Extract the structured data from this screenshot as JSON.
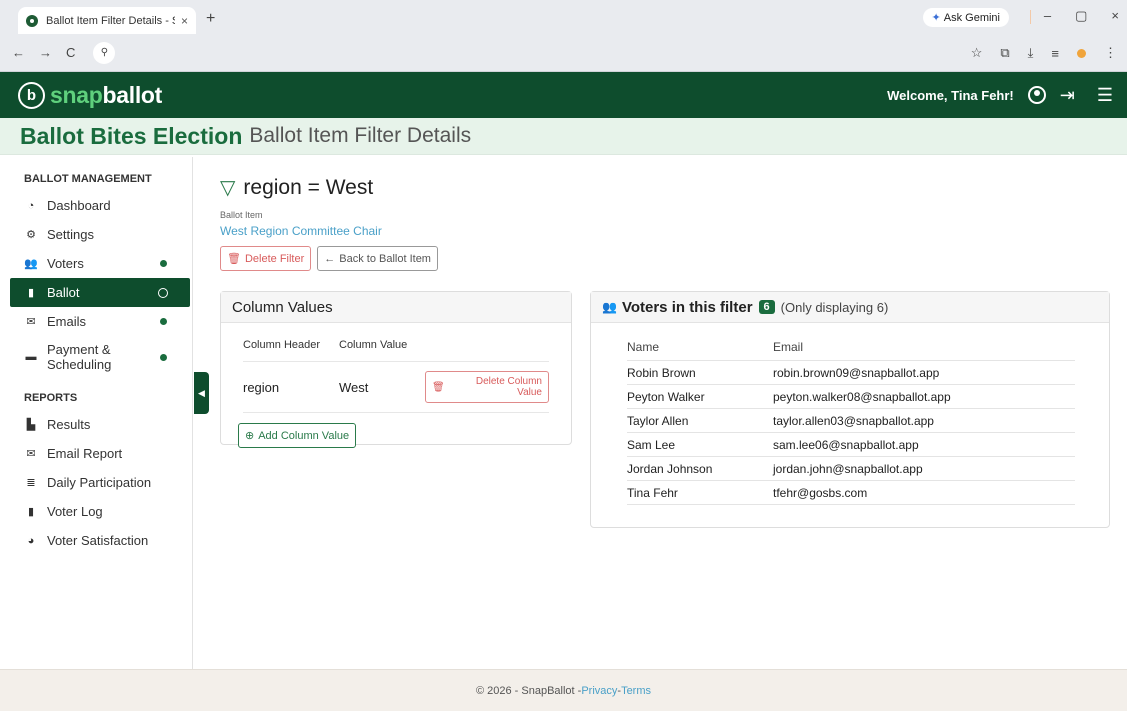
{
  "browser": {
    "tab_title": "Ballot Item Filter Details - Snap",
    "tab_close": "×",
    "new_tab": "+",
    "gemini_label": "Ask Gemini",
    "window_controls": [
      "–",
      "▢",
      "×"
    ],
    "nav_icons": [
      "←",
      "→",
      "C"
    ]
  },
  "app": {
    "logo_mark": "b",
    "logo_snap": "snap",
    "logo_ballot": "ballot",
    "welcome": "Welcome, Tina Fehr!"
  },
  "title": {
    "election": "Ballot Bites Election",
    "page": "Ballot Item Filter Details"
  },
  "sidebar": {
    "section_management": "BALLOT MANAGEMENT",
    "section_reports": "REPORTS",
    "items": [
      {
        "label": "Dashboard",
        "icon": "dashboard-icon",
        "glyph": "◔"
      },
      {
        "label": "Settings",
        "icon": "settings-icon",
        "glyph": "⚙"
      },
      {
        "label": "Voters",
        "icon": "voters-icon",
        "glyph": "👥"
      },
      {
        "label": "Ballot",
        "icon": "ballot-icon",
        "glyph": "▮"
      },
      {
        "label": "Emails",
        "icon": "email-icon",
        "glyph": "✉"
      },
      {
        "label": "Payment & Scheduling",
        "icon": "payment-icon",
        "glyph": "▬"
      }
    ],
    "reports": [
      {
        "label": "Results",
        "icon": "results-icon",
        "glyph": "▙"
      },
      {
        "label": "Email Report",
        "icon": "email-report-icon",
        "glyph": "✉"
      },
      {
        "label": "Daily Participation",
        "icon": "participation-icon",
        "glyph": "≣"
      },
      {
        "label": "Voter Log",
        "icon": "voter-log-icon",
        "glyph": "▮"
      },
      {
        "label": "Voter Satisfaction",
        "icon": "satisfaction-icon",
        "glyph": "◕"
      }
    ]
  },
  "filter": {
    "field": "region",
    "operator": "=",
    "value": "West",
    "ballot_item_label": "Ballot Item",
    "ballot_item_name": "West Region Committee Chair",
    "delete_filter": "Delete Filter",
    "back": "Back to Ballot Item"
  },
  "column_values": {
    "title": "Column Values",
    "headers": [
      "Column Header",
      "Column Value"
    ],
    "rows": [
      {
        "header": "region",
        "value": "West",
        "action": "Delete Column Value"
      }
    ],
    "add_label": "Add Column Value"
  },
  "voters": {
    "title": "Voters in this filter",
    "count": "6",
    "note": "(Only displaying 6)",
    "headers": [
      "Name",
      "Email"
    ],
    "rows": [
      {
        "name": "Robin Brown",
        "email": "robin.brown09@snapballot.app"
      },
      {
        "name": "Peyton Walker",
        "email": "peyton.walker08@snapballot.app"
      },
      {
        "name": "Taylor Allen",
        "email": "taylor.allen03@snapballot.app"
      },
      {
        "name": "Sam Lee",
        "email": "sam.lee06@snapballot.app"
      },
      {
        "name": "Jordan Johnson",
        "email": "jordan.john@snapballot.app"
      },
      {
        "name": "Tina Fehr",
        "email": "tfehr@gosbs.com"
      }
    ]
  },
  "footer": {
    "copyright": "© 2026 - SnapBallot - ",
    "privacy": "Privacy",
    "sep": " - ",
    "terms": "Terms"
  },
  "colors": {
    "brand_dark": "#0e4d2d",
    "brand_green": "#1a6c3e",
    "link": "#4aa0c8",
    "danger": "#d85b5b"
  }
}
